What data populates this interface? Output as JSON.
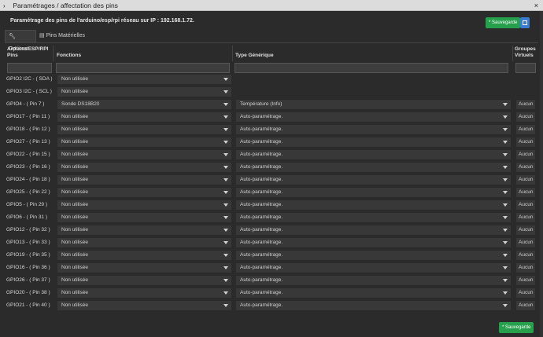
{
  "window": {
    "title": "Paramétrages / affectation des pins",
    "close": "×",
    "chevron": "›"
  },
  "subtitle": "Paramétrage des pins de l'arduino/esp/rpi réseau sur IP : 192.168.1.72.",
  "save_label": "* Sauvegarde",
  "tabs": [
    {
      "label": "Options",
      "icon": "wrench-icon"
    },
    {
      "label": "Pins Matérielles",
      "icon": "table-icon"
    }
  ],
  "headers": {
    "pins_line1": "Arduino/ESP/RPI",
    "pins_line2": "Pins",
    "fonctions": "Fonctions",
    "type": "Type Générique",
    "groupes_line1": "Groupes",
    "groupes_line2": "Virtuels"
  },
  "rows": [
    {
      "pin": "GPIO2 I2C - ( SDA )",
      "fonction": "Non utilisée",
      "type": "",
      "groupe": ""
    },
    {
      "pin": "GPIO3 I2C - ( SCL )",
      "fonction": "Non utilisée",
      "type": "",
      "groupe": ""
    },
    {
      "pin": "GPIO4 - ( Pin 7 )",
      "fonction": "Sonde DS18B20",
      "type": "Température (Info)",
      "groupe": "Aucun"
    },
    {
      "pin": "GPIO17 - ( Pin 11 )",
      "fonction": "Non utilisée",
      "type": "Auto-paramétrage.",
      "groupe": "Aucun"
    },
    {
      "pin": "GPIO18 - ( Pin 12 )",
      "fonction": "Non utilisée",
      "type": "Auto-paramétrage.",
      "groupe": "Aucun"
    },
    {
      "pin": "GPIO27 - ( Pin 13 )",
      "fonction": "Non utilisée",
      "type": "Auto-paramétrage.",
      "groupe": "Aucun"
    },
    {
      "pin": "GPIO22 - ( Pin 15 )",
      "fonction": "Non utilisée",
      "type": "Auto-paramétrage.",
      "groupe": "Aucun"
    },
    {
      "pin": "GPIO23 - ( Pin 16 )",
      "fonction": "Non utilisée",
      "type": "Auto-paramétrage.",
      "groupe": "Aucun"
    },
    {
      "pin": "GPIO24 - ( Pin 18 )",
      "fonction": "Non utilisée",
      "type": "Auto-paramétrage.",
      "groupe": "Aucun"
    },
    {
      "pin": "GPIO25 - ( Pin 22 )",
      "fonction": "Non utilisée",
      "type": "Auto-paramétrage.",
      "groupe": "Aucun"
    },
    {
      "pin": "GPIO5 - ( Pin 29 )",
      "fonction": "Non utilisée",
      "type": "Auto-paramétrage.",
      "groupe": "Aucun"
    },
    {
      "pin": "GPIO6 - ( Pin 31 )",
      "fonction": "Non utilisée",
      "type": "Auto-paramétrage.",
      "groupe": "Aucun"
    },
    {
      "pin": "GPIO12 - ( Pin 32 )",
      "fonction": "Non utilisée",
      "type": "Auto-paramétrage.",
      "groupe": "Aucun"
    },
    {
      "pin": "GPIO13 - ( Pin 33 )",
      "fonction": "Non utilisée",
      "type": "Auto-paramétrage.",
      "groupe": "Aucun"
    },
    {
      "pin": "GPIO19 - ( Pin 35 )",
      "fonction": "Non utilisée",
      "type": "Auto-paramétrage.",
      "groupe": "Aucun"
    },
    {
      "pin": "GPIO16 - ( Pin 36 )",
      "fonction": "Non utilisée",
      "type": "Auto-paramétrage.",
      "groupe": "Aucun"
    },
    {
      "pin": "GPIO26 - ( Pin 37 )",
      "fonction": "Non utilisée",
      "type": "Auto-paramétrage.",
      "groupe": "Aucun"
    },
    {
      "pin": "GPIO20 - ( Pin 38 )",
      "fonction": "Non utilisée",
      "type": "Auto-paramétrage.",
      "groupe": "Aucun"
    },
    {
      "pin": "GPIO21 - ( Pin 40 )",
      "fonction": "Non utilisée",
      "type": "Auto-paramétrage.",
      "groupe": "Aucun"
    }
  ],
  "colors": {
    "save": "#27a04d",
    "accent": "#3a7bd5",
    "background": "#2b2b2b"
  }
}
